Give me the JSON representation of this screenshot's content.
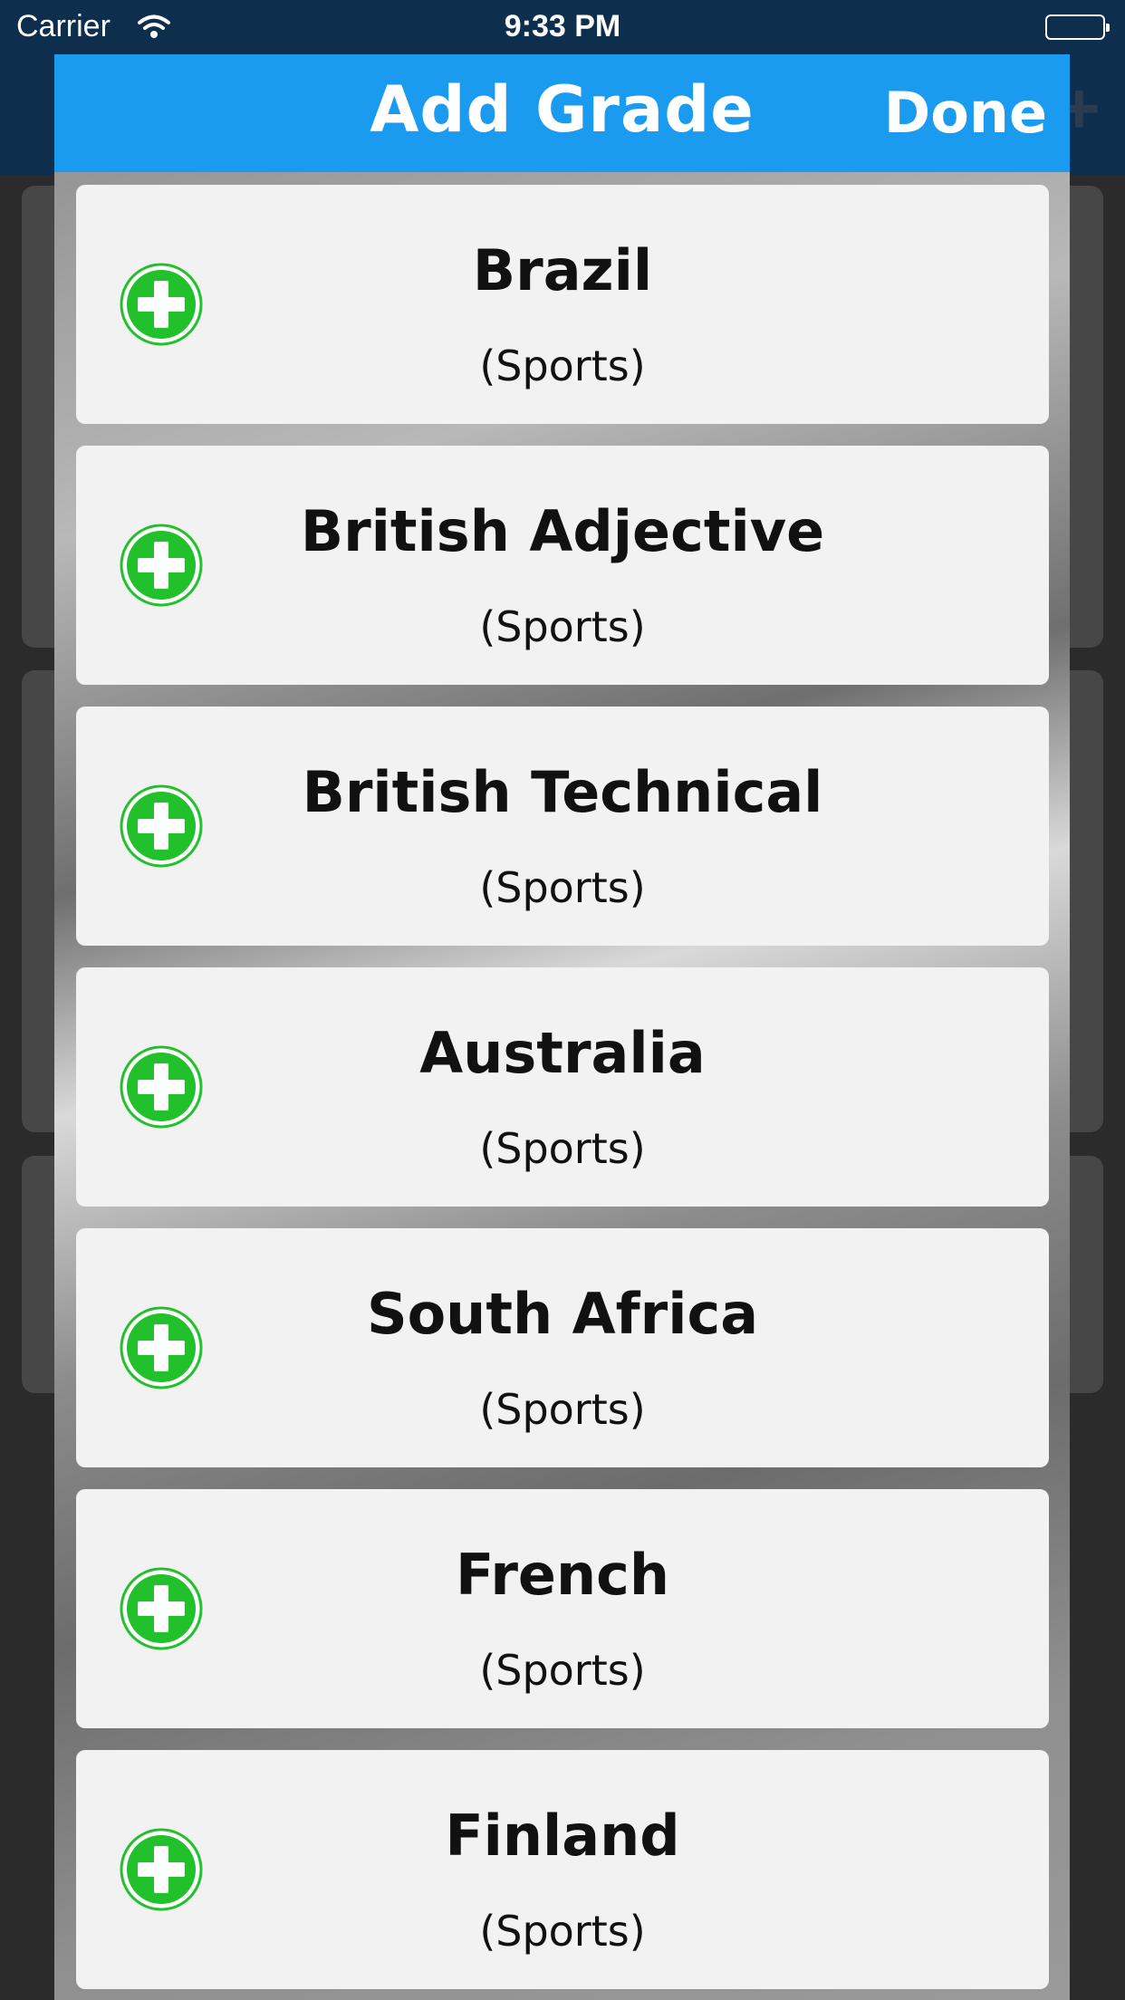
{
  "status_bar": {
    "carrier": "Carrier",
    "time": "9:33 PM",
    "icons": [
      "wifi-icon",
      "battery-icon"
    ]
  },
  "background": {
    "icons": [
      "plus-icon"
    ]
  },
  "modal": {
    "title": "Add Grade",
    "done_label": "Done",
    "accent_color": "#1a9bf0",
    "add_icon_color": "#22c02a",
    "grades": [
      {
        "name": "Brazil",
        "category": "(Sports)"
      },
      {
        "name": "British Adjective",
        "category": "(Sports)"
      },
      {
        "name": "British Technical",
        "category": "(Sports)"
      },
      {
        "name": "Australia",
        "category": "(Sports)"
      },
      {
        "name": "South Africa",
        "category": "(Sports)"
      },
      {
        "name": "French",
        "category": "(Sports)"
      },
      {
        "name": "Finland",
        "category": "(Sports)"
      }
    ]
  }
}
